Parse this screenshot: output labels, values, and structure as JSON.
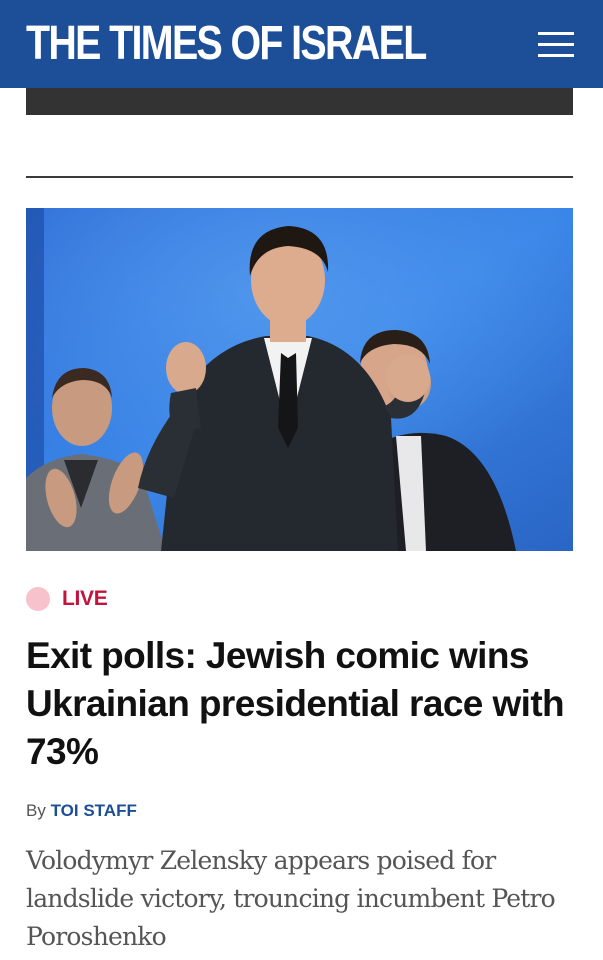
{
  "header": {
    "logo_text": "THE TIMES OF ISRAEL",
    "menu_icon": "hamburger-menu-icon",
    "background_color": "#1d4f98"
  },
  "article": {
    "live_label": "LIVE",
    "headline": "Exit polls: Jewish comic wins Ukrainian presidential race with 73%",
    "byline_prefix": "By",
    "byline_author": "TOI STAFF",
    "dek": "Volodymyr Zelensky appears poised for landslide victory, trouncing incumbent Petro Poroshenko"
  },
  "colors": {
    "brand_blue": "#1d4f98",
    "live_red": "#c0143c",
    "live_dot_pink": "#f7c2cb"
  }
}
